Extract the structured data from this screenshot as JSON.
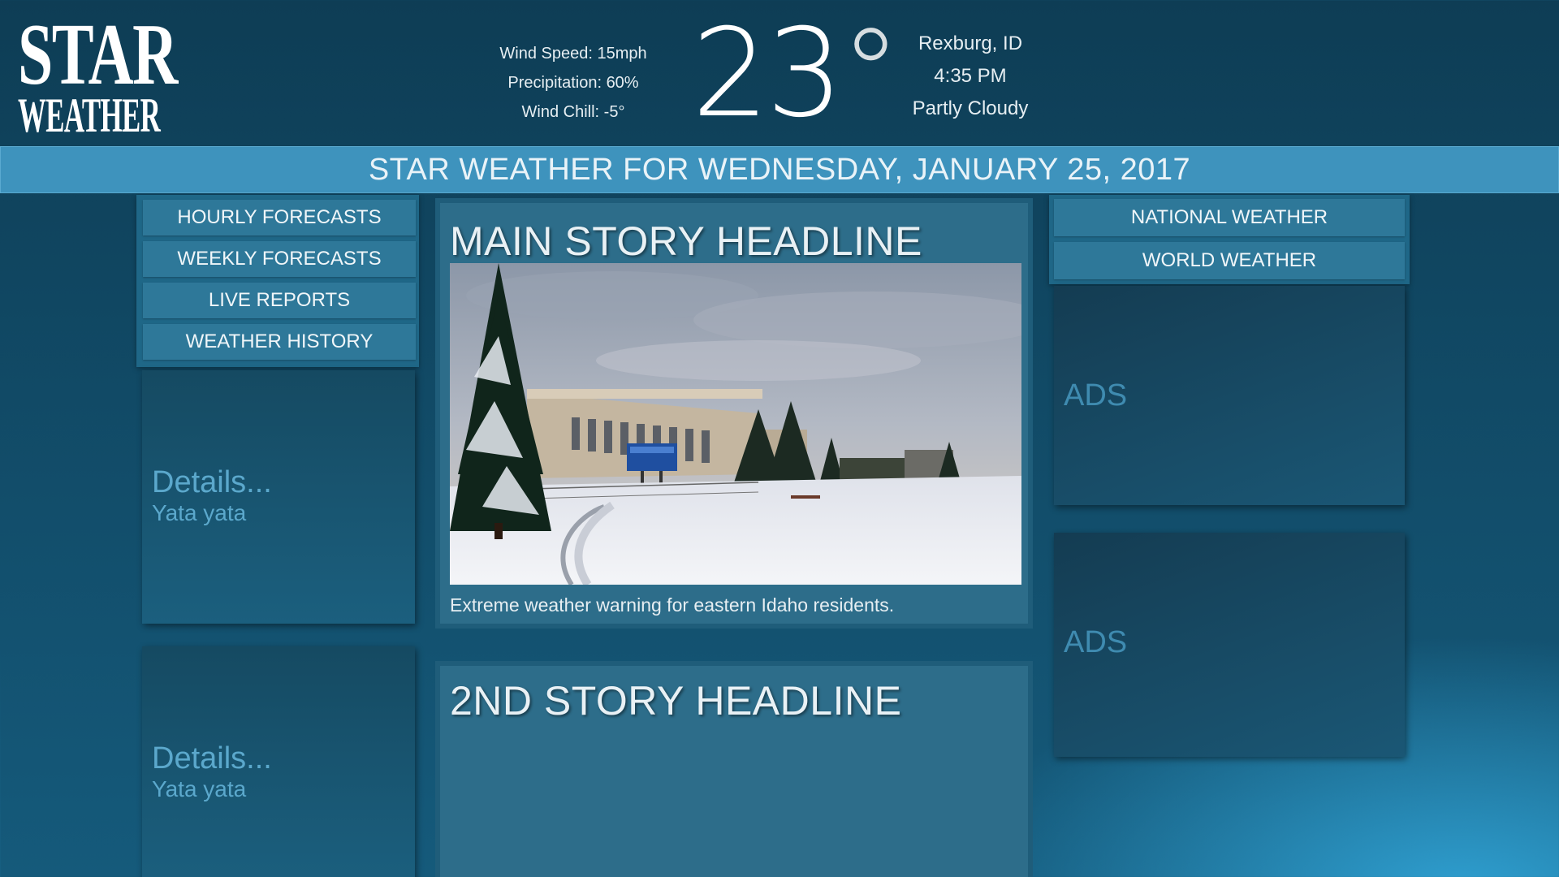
{
  "brand": {
    "line1": "STAR",
    "line2": "WEATHER"
  },
  "conditions": {
    "wind_speed": "Wind Speed: 15mph",
    "precipitation": "Precipitation: 60%",
    "wind_chill": "Wind Chill: -5°",
    "temperature": "23",
    "degree_symbol": "°",
    "location": "Rexburg, ID",
    "time": "4:35 PM",
    "sky": "Partly Cloudy"
  },
  "date_banner": "STAR WEATHER FOR WEDNESDAY, JANUARY 25, 2017",
  "left_nav": {
    "items": [
      {
        "label": "HOURLY FORECASTS"
      },
      {
        "label": "WEEKLY FORECASTS"
      },
      {
        "label": "LIVE REPORTS"
      },
      {
        "label": "WEATHER HISTORY"
      }
    ]
  },
  "detail_cards": [
    {
      "title": "Details...",
      "subtitle": "Yata yata"
    },
    {
      "title": "Details...",
      "subtitle": "Yata yata"
    }
  ],
  "main_story": {
    "headline": "MAIN STORY HEADLINE",
    "caption": "Extreme weather warning for eastern Idaho residents."
  },
  "second_story": {
    "headline": "2ND STORY HEADLINE"
  },
  "right_nav": {
    "items": [
      {
        "label": "NATIONAL WEATHER"
      },
      {
        "label": "WORLD WEATHER"
      }
    ]
  },
  "ads": [
    {
      "label": "ADS"
    },
    {
      "label": "ADS"
    }
  ],
  "colors": {
    "background": "#114a66",
    "banner": "#3e93bd",
    "button": "#2e7899",
    "story_panel": "#2d6d8a",
    "muted_text": "#5ba8cc"
  }
}
